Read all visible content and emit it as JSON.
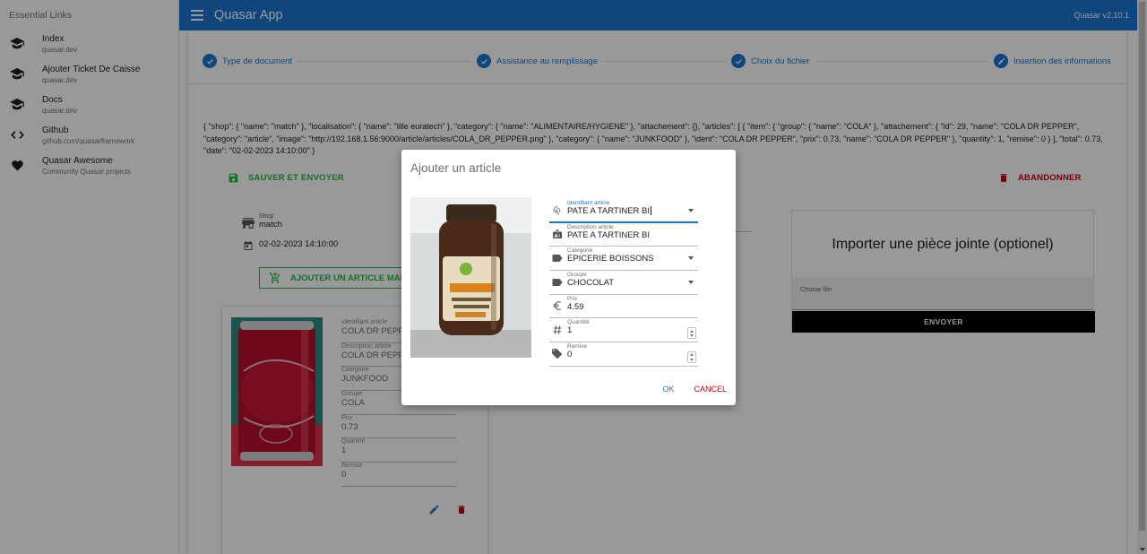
{
  "drawer": {
    "header": "Essential Links",
    "items": [
      {
        "title": "Index",
        "caption": "quasar.dev",
        "icon": "school-icon"
      },
      {
        "title": "Ajouter Ticket De Caisse",
        "caption": "quasar.dev",
        "icon": "school-icon"
      },
      {
        "title": "Docs",
        "caption": "quasar.dev",
        "icon": "school-icon"
      },
      {
        "title": "Github",
        "caption": "github.com/quasarframework",
        "icon": "code-icon"
      },
      {
        "title": "Quasar Awesome",
        "caption": "Community Quasar projects",
        "icon": "heart-icon"
      }
    ]
  },
  "header": {
    "title": "Quasar App",
    "version": "Quasar v2.10.1"
  },
  "stepper": {
    "steps": [
      {
        "label": "Type de document",
        "icon": "check-icon"
      },
      {
        "label": "Assistance au remplissage",
        "icon": "check-icon"
      },
      {
        "label": "Choix du fichier",
        "icon": "check-icon"
      },
      {
        "label": "Insertion des informations",
        "icon": "edit-icon"
      }
    ]
  },
  "json_dump": "{ \"shop\": { \"name\": \"match\" }, \"localisation\": { \"name\": \"lille euratech\" }, \"category\": { \"name\": \"ALIMENTAIRE/HYGIENE\" }, \"attachement\": {}, \"articles\": [ { \"item\": { \"group\": { \"name\": \"COLA\" }, \"attachement\": { \"id\": 29, \"name\": \"COLA DR PEPPER\", \"category\": \"article\", \"image\": \"http://192.168.1.56:9000/article/articles/COLA_DR_PEPPER.png\" }, \"category\": { \"name\": \"JUNKFOOD\" }, \"ident\": \"COLA DR PEPPER\", \"prix\": 0.73, \"name\": \"COLA DR PEPPER\" }, \"quantity\": 1, \"remise\": 0 } ], \"total\": 0.73, \"date\": \"02-02-2023 14:10:00\" }",
  "actions": {
    "save": "SAUVER ET ENVOYER",
    "abandon": "ABANDONNER"
  },
  "ticket": {
    "shop_label": "Shop",
    "shop_value": "match",
    "date_value": "02-02-2023 14:10:00",
    "manual_button": "AJOUTER UN ARTICLE MANUELLEMENT"
  },
  "article_card": {
    "fields": [
      {
        "label": "Identifiant article",
        "value": "COLA DR PEPPER"
      },
      {
        "label": "Description article",
        "value": "COLA DR PEPPER"
      },
      {
        "label": "Categorie",
        "value": "JUNKFOOD"
      },
      {
        "label": "Groupe",
        "value": "COLA"
      },
      {
        "label": "Prix",
        "value": "0.73"
      },
      {
        "label": "Quantité",
        "value": "1"
      },
      {
        "label": "Remise",
        "value": "0"
      }
    ]
  },
  "import": {
    "title": "Importer une pièce jointe (optionel)",
    "choose_file": "Choise file",
    "send": "ENVOYER"
  },
  "dialog": {
    "title": "Ajouter un article",
    "fields": [
      {
        "label": "Identifiant article",
        "value": "PATE A TARTINER BI",
        "icon": "fingerprint-icon",
        "type": "select"
      },
      {
        "label": "Description article",
        "value": "PATE A TARTINER BI",
        "icon": "badge-icon",
        "type": "text"
      },
      {
        "label": "Categorie",
        "value": "EPICERIE BOISSONS",
        "icon": "label-icon",
        "type": "select"
      },
      {
        "label": "Groupe",
        "value": "CHOCOLAT",
        "icon": "label-icon",
        "type": "select"
      },
      {
        "label": "Prix",
        "value": "4.59",
        "icon": "euro-icon",
        "type": "text"
      },
      {
        "label": "Quantité",
        "value": "1",
        "icon": "hash-icon",
        "type": "number"
      },
      {
        "label": "Remise",
        "value": "0",
        "icon": "tags-icon",
        "type": "number"
      }
    ],
    "ok": "OK",
    "cancel": "CANCEL"
  },
  "colors": {
    "primary": "#1976d2",
    "positive": "#21ba45",
    "negative": "#c10015"
  }
}
